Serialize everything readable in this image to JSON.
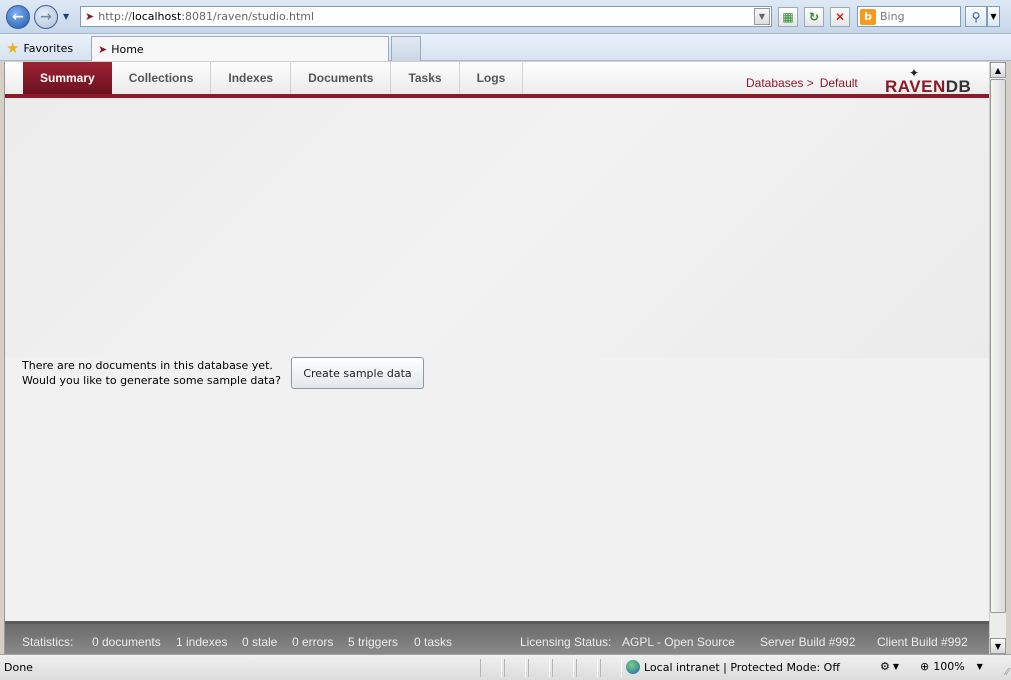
{
  "browser": {
    "url_scheme": "http://",
    "url_host": "localhost",
    "url_rest": ":8081/raven/studio.html",
    "search_placeholder": "Bing",
    "favorites_label": "Favorites",
    "tab_title": "Home"
  },
  "app": {
    "nav_tabs": [
      {
        "label": "Summary",
        "active": true
      },
      {
        "label": "Collections"
      },
      {
        "label": "Indexes"
      },
      {
        "label": "Documents"
      },
      {
        "label": "Tasks"
      },
      {
        "label": "Logs"
      }
    ],
    "breadcrumb": {
      "root": "Databases >",
      "current": "Default"
    },
    "logo": {
      "part1": "RAVEN",
      "part2": "DB"
    },
    "empty_line1": "There are no documents in this database yet.",
    "empty_line2": "Would you like to generate some sample data?",
    "create_sample_label": "Create sample data"
  },
  "statistics": {
    "label": "Statistics:",
    "documents": "0 documents",
    "indexes": "1 indexes",
    "stale": "0 stale",
    "errors": "0 errors",
    "triggers": "5 triggers",
    "tasks": "0 tasks",
    "licensing_label": "Licensing Status:",
    "licensing_value": "AGPL - Open Source",
    "server_build": "Server Build #992",
    "client_build": "Client Build #992"
  },
  "ie_status": {
    "done": "Done",
    "zone": "Local intranet | Protected Mode: Off",
    "zoom": "100%"
  },
  "colors": {
    "accent": "#8b1a2b",
    "status_bg": "#7a7a7a"
  }
}
